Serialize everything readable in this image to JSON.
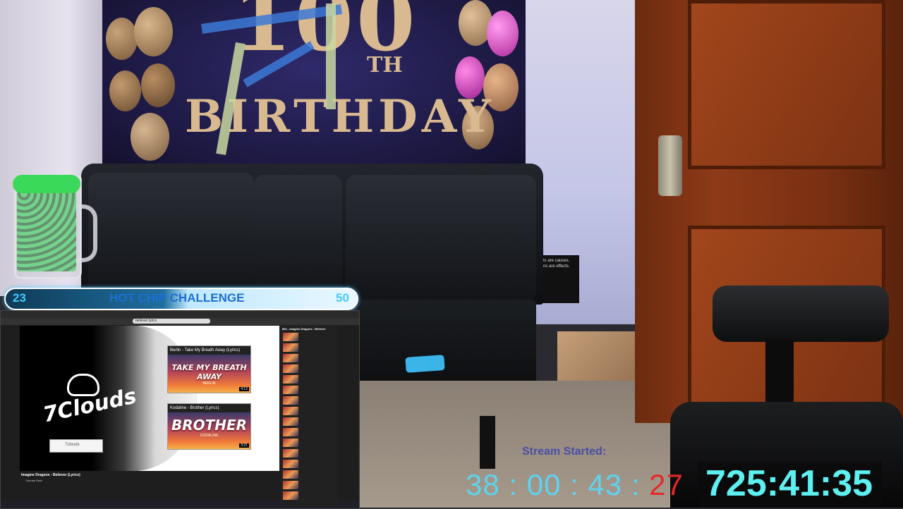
{
  "banner": {
    "number": "100",
    "suffix": "TH",
    "word": "BIRTHDAY"
  },
  "challenge": {
    "current": "23",
    "title": "HOT CHIP CHALLENGE",
    "goal": "50",
    "colors": {
      "bar_dark": "#0f3a55",
      "bar_light": "#eaf8ff",
      "text": "#1d6fd1",
      "numbers": "#46c8ff"
    }
  },
  "browser": {
    "search_query": "believer lyrics",
    "video_title": "Imagine Dragons - Believer (Lyrics)",
    "channel": "7clouds Rock",
    "logo_text": "7Clouds",
    "subscribe_label": "7clouds",
    "playlist_title": "Mix - Imagine Dragons - Believer",
    "cards": [
      {
        "title": "Berlin - Take My Breath Away (Lyrics)",
        "art_text": "TAKE MY BREATH AWAY",
        "artist": "BERLIN",
        "duration": "4:12"
      },
      {
        "title": "Kodaline - Brother (Lyrics)",
        "art_text": "BROTHER",
        "artist": "CODALINE",
        "duration": "3:21"
      }
    ],
    "playlist_items": [
      "",
      "",
      "",
      "",
      "",
      "",
      "",
      "",
      "",
      "",
      "",
      "",
      "",
      "",
      "",
      ""
    ]
  },
  "sign": {
    "text": "...ts are causes. ...ns are effects."
  },
  "timers": {
    "stream_label": "Stream Started:",
    "stream_hms": "38 : 00 : 43 : ",
    "stream_secs": "27",
    "big": "725:41:35",
    "colors": {
      "stream": "#5ed2ee",
      "secs": "#e32a2a",
      "big": "#5ef0f0"
    }
  }
}
